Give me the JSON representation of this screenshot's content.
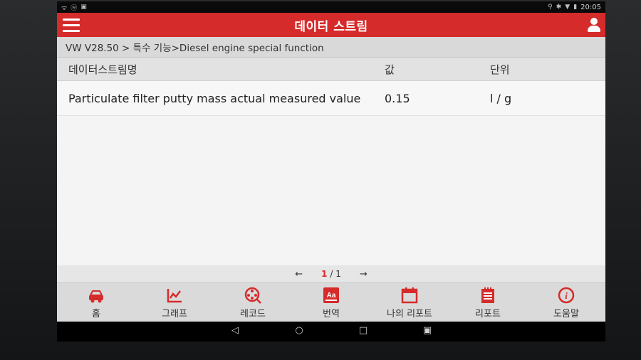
{
  "status_bar": {
    "left_icons": [
      "usb-icon",
      "android-icon",
      "image-icon"
    ],
    "left_glyphs": [
      "ᯤ",
      "ⓦ",
      "▣"
    ],
    "right_icons": [
      "location-icon",
      "bluetooth-icon",
      "wifi-icon",
      "battery-icon"
    ],
    "right_glyphs": [
      "⚲",
      "✱",
      "▼",
      "▮"
    ],
    "time": "20:05"
  },
  "app_bar": {
    "title": "데이터 스트림",
    "menu_icon": "hamburger-menu-icon",
    "user_icon": "user-profile-icon",
    "background": "#d52b2b"
  },
  "breadcrumb": {
    "text": "VW V28.50 > 특수 기능>Diesel engine special function"
  },
  "table": {
    "headers": {
      "name": "데이터스트림명",
      "value": "값",
      "unit": "단위"
    },
    "rows": [
      {
        "name": "Particulate filter putty mass actual measured value",
        "value": "0.15",
        "unit": "l / g"
      }
    ]
  },
  "pager": {
    "prev_icon": "arrow-left-icon",
    "prev_glyph": "←",
    "current": "1",
    "separator": "/",
    "total": "1",
    "next_icon": "arrow-right-icon",
    "next_glyph": "→"
  },
  "bottom_nav": {
    "accent": "#d52b2b",
    "items": [
      {
        "label": "홈",
        "icon": "car-home-icon"
      },
      {
        "label": "그래프",
        "icon": "graph-icon"
      },
      {
        "label": "레코드",
        "icon": "record-icon"
      },
      {
        "label": "번역",
        "icon": "translate-icon"
      },
      {
        "label": "나의 리포트",
        "icon": "my-report-icon"
      },
      {
        "label": "리포트",
        "icon": "report-icon"
      },
      {
        "label": "도움말",
        "icon": "help-icon"
      }
    ]
  },
  "system_nav": {
    "back_glyph": "◁",
    "home_glyph": "○",
    "recents_glyph": "□",
    "screenshot_glyph": "▣"
  }
}
